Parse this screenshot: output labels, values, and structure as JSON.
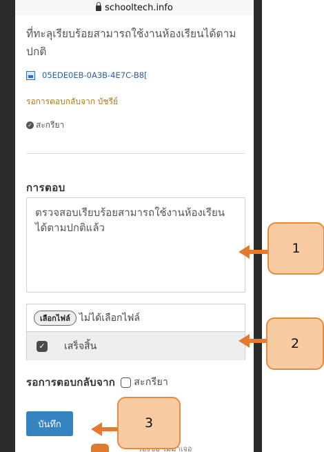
{
  "browser": {
    "url": "schooltech.info"
  },
  "message": {
    "text": "ที่ทะลุเรียบร้อยสามารถใช้งานห้องเรียนได้ตามปกติ",
    "attachment_name": "05EDE0EB-0A3B-4E7C-B8[",
    "waiting_from": "รอการตอบกลับจาก บัชรีย์",
    "status_done": "สะกรียา"
  },
  "reply": {
    "heading": "การตอบ",
    "text": "ตรวจสอบเรียบร้อยสามารถใช้งานห้องเรียนได้ตามปกติแล้ว"
  },
  "file": {
    "choose_label": "เลือกไฟล์",
    "no_file_text": "ไม่ได้เลือกไฟล์",
    "finish_label": "เสร็จสิ้น"
  },
  "await": {
    "label": "รอการตอบกลับจาก",
    "checkbox_label": "สะกรียา"
  },
  "save_label": "บันทึก",
  "bottom_peek_text": "ร้องขอ ไม่มาเจอ",
  "callouts": {
    "one": "1",
    "two": "2",
    "three": "3"
  },
  "colors": {
    "callout_fill": "#f9cba3",
    "callout_border": "#e88a3a",
    "arrow": "#e8792b",
    "save_button": "#3683c2"
  }
}
